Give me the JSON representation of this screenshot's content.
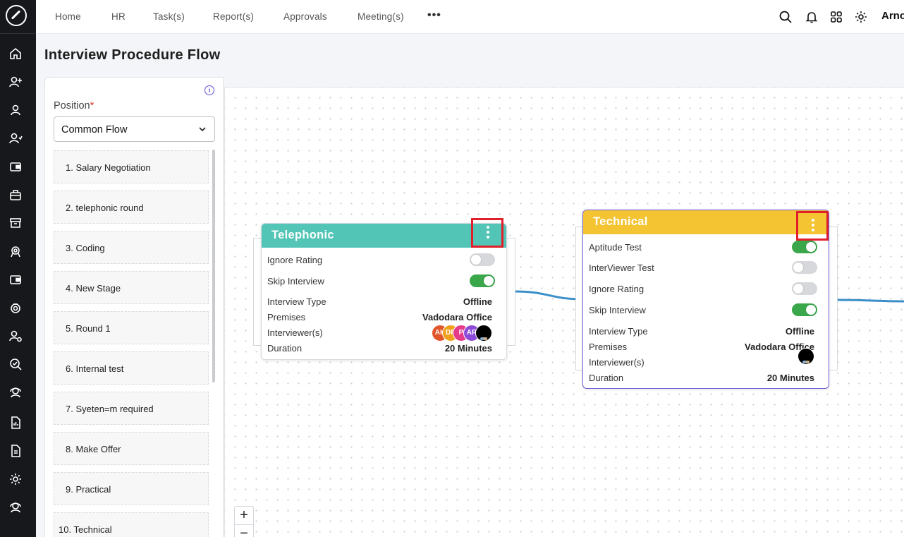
{
  "nav": {
    "items": [
      "Home",
      "HR",
      "Task(s)",
      "Report(s)",
      "Approvals",
      "Meeting(s)"
    ],
    "more": "•••",
    "user_name": "Arno"
  },
  "sidebar_icons": [
    "home-icon",
    "user-plus-icon",
    "user-icon",
    "user-add-icon",
    "wallet-icon",
    "briefcase-icon",
    "archive-icon",
    "award-icon",
    "card-icon",
    "badge-icon",
    "user-settings-icon",
    "search-check-icon",
    "headset-icon",
    "report-icon",
    "document-icon",
    "settings-icon",
    "support-icon"
  ],
  "topbar_icons": [
    "search-icon",
    "bell-icon",
    "grid-icon",
    "gear-icon"
  ],
  "page": {
    "title": "Interview Procedure Flow"
  },
  "panel": {
    "position_label": "Position",
    "required_mark": "*",
    "position_value": "Common Flow",
    "stages": [
      "1. Salary Negotiation",
      "2. telephonic round",
      "3. Coding",
      "4. New Stage",
      "5. Round 1",
      "6. Internal test",
      "7. Syeten=m required",
      "8. Make Offer",
      "9. Practical",
      "10. Technical"
    ]
  },
  "colors": {
    "telephonic_header": "#52c5b6",
    "technical_header": "#f4c433",
    "technical_border": "#6b5fdc",
    "highlight_box": "#e01f2a",
    "toggle_on": "#3aa84a",
    "edge": "#3a8fc9"
  },
  "telephonic": {
    "title": "Telephonic",
    "ignore_rating_label": "Ignore Rating",
    "ignore_rating_on": false,
    "skip_interview_label": "Skip Interview",
    "skip_interview_on": true,
    "interview_type_label": "Interview Type",
    "interview_type": "Offline",
    "premises_label": "Premises",
    "premises": "Vadodara Office",
    "interviewers_label": "Interviewer(s)",
    "interviewers": [
      {
        "initials": "AK",
        "color": "#e0562a"
      },
      {
        "initials": "DP",
        "color": "#f0a01c"
      },
      {
        "initials": "P",
        "color": "#e63a8a"
      },
      {
        "initials": "AR",
        "color": "#8c4ad8"
      },
      {
        "initials": "",
        "color": "#000000"
      }
    ],
    "duration_label": "Duration",
    "duration": "20 Minutes"
  },
  "technical": {
    "title": "Technical",
    "aptitude_label": "Aptitude Test",
    "aptitude_on": true,
    "interviewer_test_label": "InterViewer Test",
    "interviewer_test_on": false,
    "ignore_rating_label": "Ignore Rating",
    "ignore_rating_on": false,
    "skip_interview_label": "Skip Interview",
    "skip_interview_on": true,
    "interview_type_label": "Interview Type",
    "interview_type": "Offline",
    "premises_label": "Premises",
    "premises": "Vadodara Office",
    "interviewers_label": "Interviewer(s)",
    "duration_label": "Duration",
    "duration": "20 Minutes"
  },
  "zoom": {
    "in": "+",
    "out": "−"
  }
}
